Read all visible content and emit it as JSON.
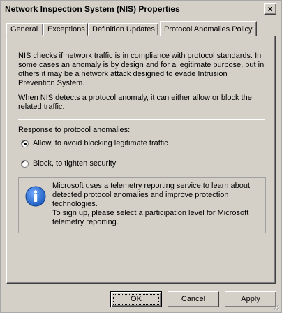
{
  "window": {
    "title": "Network Inspection System (NIS) Properties",
    "close_glyph": "x"
  },
  "tabs": [
    {
      "label": "General",
      "active": false
    },
    {
      "label": "Exceptions",
      "active": false
    },
    {
      "label": "Definition Updates",
      "active": false
    },
    {
      "label": "Protocol Anomalies Policy",
      "active": true
    }
  ],
  "content": {
    "description1": "NIS checks if network traffic  is in compliance with protocol standards. In some cases an anomaly is by design and for a legitimate purpose, but in others it may be a network attack designed to evade Intrusion Prevention System.",
    "description2": "When NIS detects a protocol anomaly, it can either allow or block the related traffic.",
    "response_label": "Response to protocol anomalies:",
    "options": [
      {
        "label": "Allow, to avoid blocking legitimate traffic",
        "checked": true
      },
      {
        "label": "Block, to tighten security",
        "checked": false
      }
    ],
    "info": {
      "icon": "info-icon",
      "line1": "Microsoft uses a telemetry reporting service to learn about detected protocol anomalies and improve protection technologies.",
      "line2": "To sign up, please select a participation level for Microsoft telemetry reporting."
    }
  },
  "buttons": {
    "ok": "OK",
    "cancel": "Cancel",
    "apply": "Apply"
  },
  "colors": {
    "window_bg": "#d4d0c8",
    "info_icon": "#1f5fbf"
  }
}
